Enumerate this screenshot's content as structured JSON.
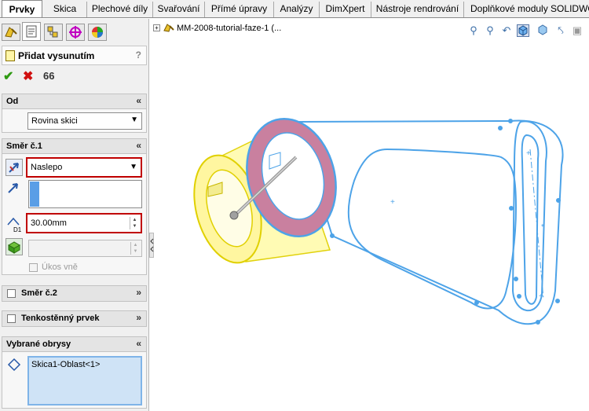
{
  "tabs": [
    {
      "label": "Prvky",
      "active": true
    },
    {
      "label": "Skica",
      "active": false
    },
    {
      "label": "Plechové díly",
      "active": false
    },
    {
      "label": "Svařování",
      "active": false
    },
    {
      "label": "Přímé úpravy",
      "active": false
    },
    {
      "label": "Analýzy",
      "active": false
    },
    {
      "label": "DimXpert",
      "active": false
    },
    {
      "label": "Nástroje rendrování",
      "active": false
    },
    {
      "label": "Doplňkové moduly SOLIDWO",
      "active": false
    }
  ],
  "panel": {
    "tab_icons": [
      "feature-manager-icon",
      "property-manager-icon",
      "configuration-manager-icon",
      "dimxpert-manager-icon",
      "display-manager-icon"
    ],
    "title": "Přidat vysunutím",
    "help_label": "?",
    "actions": {
      "ok": "✔",
      "cancel": "✖",
      "preview": "66"
    },
    "from": {
      "header": "Od",
      "value": "Rovina skici"
    },
    "dir1": {
      "header": "Směr č.1",
      "end_condition": "Naslepo",
      "depth": "30.00mm",
      "draft_label": "Úkos vně"
    },
    "dir2": {
      "header": "Směr č.2"
    },
    "thin": {
      "header": "Tenkostěnný prvek"
    },
    "contours": {
      "header": "Vybrané obrysy",
      "item": "Skica1-Oblast<1>"
    }
  },
  "tree": {
    "root": "MM-2008-tutorial-faze-1  (..."
  },
  "view_toolbar": [
    "zoom-to-fit-icon",
    "zoom-to-area-icon",
    "previous-view-icon",
    "view-orientation-icon",
    "display-style-icon",
    "hide-show-items-icon",
    "section-view-icon"
  ],
  "colors": {
    "accent": "#c00000",
    "sketch": "#4da3e8",
    "preview_fill": "#fffbb0",
    "preview_edge": "#e0d000",
    "selected_face": "#c9809f"
  }
}
